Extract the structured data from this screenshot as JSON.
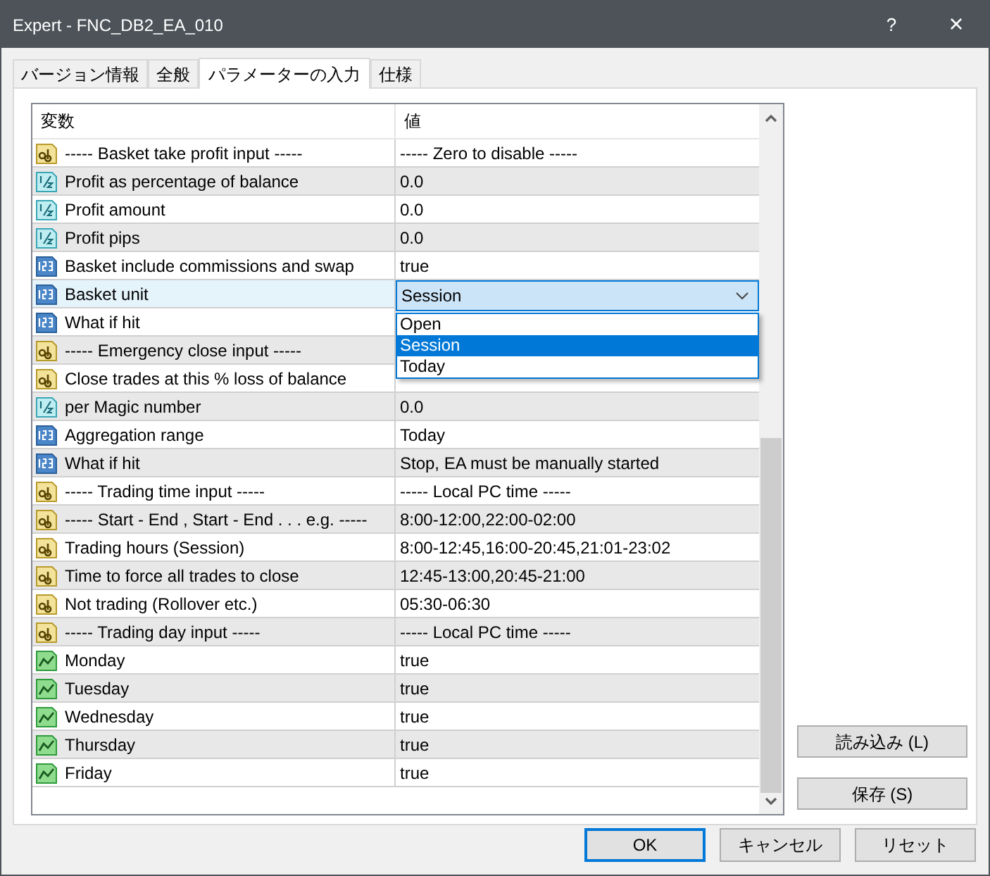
{
  "window": {
    "title": "Expert - FNC_DB2_EA_010",
    "help": "?",
    "close": "×"
  },
  "tabs": [
    {
      "label": "バージョン情報",
      "selected": false
    },
    {
      "label": "全般",
      "selected": false
    },
    {
      "label": "パラメーターの入力",
      "selected": true
    },
    {
      "label": "仕様",
      "selected": false
    }
  ],
  "table": {
    "columns": [
      "変数",
      "値"
    ],
    "rows": [
      {
        "kind": "string",
        "name": "----- Basket take profit input -----",
        "value": "----- Zero to disable -----",
        "selected": false
      },
      {
        "kind": "double",
        "name": "Profit as percentage of balance",
        "value": "0.0",
        "selected": false
      },
      {
        "kind": "double",
        "name": "Profit amount",
        "value": "0.0",
        "selected": false
      },
      {
        "kind": "double",
        "name": "Profit pips",
        "value": "0.0",
        "selected": false
      },
      {
        "kind": "int",
        "name": "Basket include commissions and swap",
        "value": "true",
        "selected": false
      },
      {
        "kind": "int",
        "name": "Basket unit",
        "selected": true,
        "dropdown": {
          "value": "Session",
          "options": [
            {
              "label": "Open",
              "selected": false
            },
            {
              "label": "Session",
              "selected": true
            },
            {
              "label": "Today",
              "selected": false
            }
          ]
        }
      },
      {
        "kind": "int",
        "name": "What if hit",
        "selected": false
      },
      {
        "kind": "string",
        "name": "----- Emergency close input -----",
        "selected": false
      },
      {
        "kind": "string",
        "name": "Close trades at this % loss of balance",
        "selected": false
      },
      {
        "kind": "double",
        "name": "per Magic number",
        "value": "0.0",
        "selected": false
      },
      {
        "kind": "int",
        "name": "Aggregation range",
        "value": "Today",
        "selected": false
      },
      {
        "kind": "int",
        "name": "What if hit",
        "value": "Stop, EA must be manually started",
        "selected": false
      },
      {
        "kind": "string",
        "name": "----- Trading time input -----",
        "value": "----- Local PC time -----",
        "selected": false
      },
      {
        "kind": "string",
        "name": "----- Start - End , Start - End . . . e.g. -----",
        "value": "8:00-12:00,22:00-02:00",
        "selected": false
      },
      {
        "kind": "string",
        "name": "Trading hours (Session)",
        "value": "8:00-12:45,16:00-20:45,21:01-23:02",
        "selected": false
      },
      {
        "kind": "string",
        "name": "Time to force all trades to close",
        "value": "12:45-13:00,20:45-21:00",
        "selected": false
      },
      {
        "kind": "string",
        "name": "Not trading (Rollover etc.)",
        "value": "05:30-06:30",
        "selected": false
      },
      {
        "kind": "string",
        "name": "----- Trading day input -----",
        "value": "----- Local PC time -----",
        "selected": false
      },
      {
        "kind": "bool",
        "name": "Monday",
        "value": "true",
        "selected": false
      },
      {
        "kind": "bool",
        "name": "Tuesday",
        "value": "true",
        "selected": false
      },
      {
        "kind": "bool",
        "name": "Wednesday",
        "value": "true",
        "selected": false
      },
      {
        "kind": "bool",
        "name": "Thursday",
        "value": "true",
        "selected": false
      },
      {
        "kind": "bool",
        "name": "Friday",
        "value": "true",
        "selected": false
      }
    ]
  },
  "side_buttons": [
    "読み込み (L)",
    "保存 (S)"
  ],
  "buttons": [
    {
      "label": "OK",
      "default": true
    },
    {
      "label": "キャンセル",
      "default": false
    },
    {
      "label": "リセット",
      "default": false
    }
  ]
}
